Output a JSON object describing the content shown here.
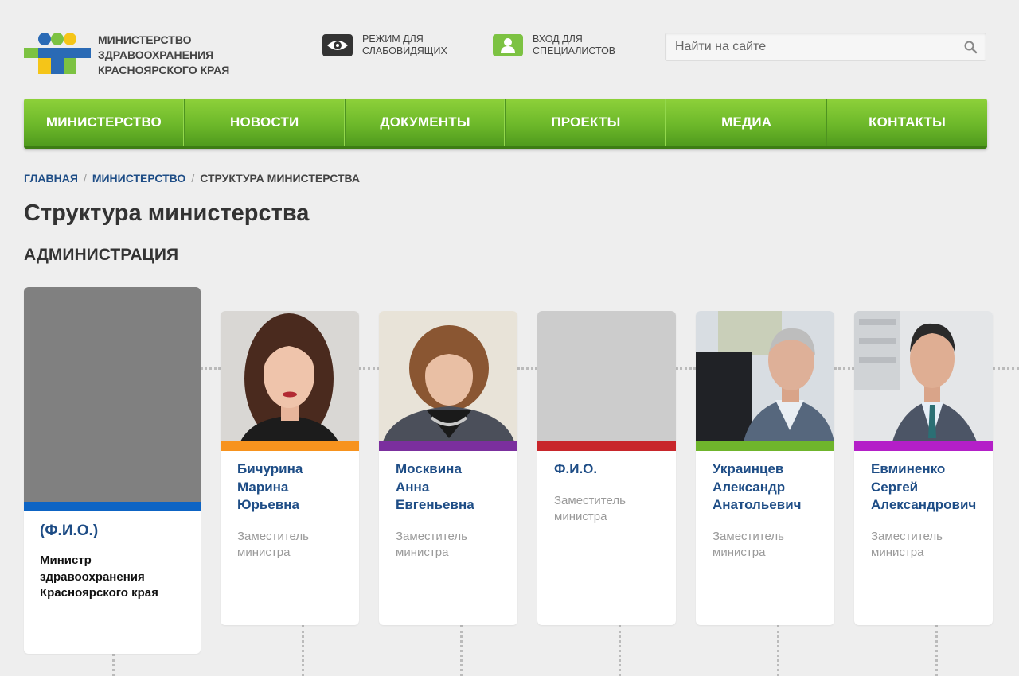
{
  "header": {
    "org_lines": [
      "МИНИСТЕРСТВО",
      "ЗДРАВООХРАНЕНИЯ",
      "КРАСНОЯРСКОГО КРАЯ"
    ],
    "vision_mode": [
      "РЕЖИМ ДЛЯ",
      "СЛАБОВИДЯЩИХ"
    ],
    "specialist_login": [
      "ВХОД ДЛЯ",
      "СПЕЦИАЛИСТОВ"
    ],
    "search_placeholder": "Найти на сайте"
  },
  "nav": {
    "items": [
      "МИНИСТЕРСТВО",
      "НОВОСТИ",
      "ДОКУМЕНТЫ",
      "ПРОЕКТЫ",
      "МЕДИА",
      "КОНТАКТЫ"
    ]
  },
  "breadcrumb": {
    "home": "ГЛАВНАЯ",
    "ministry": "МИНИСТЕРСТВО",
    "current": "СТРУКТУРА МИНИСТЕРСТВА",
    "separator": "/"
  },
  "page_title": "Структура министерства",
  "section_title": "АДМИНИСТРАЦИЯ",
  "minister": {
    "name": "(Ф.И.О.)",
    "role_lines": [
      "Министр",
      "здравоохранения",
      "Красноярского края"
    ],
    "stripe_color": "#0d64c4"
  },
  "deputies": [
    {
      "name_lines": [
        "Бичурина",
        "Марина",
        "Юрьевна"
      ],
      "role_lines": [
        "Заместитель",
        "министра"
      ],
      "stripe_color": "#f7931e"
    },
    {
      "name_lines": [
        "Москвина",
        "Анна",
        "Евгеньевна"
      ],
      "role_lines": [
        "Заместитель",
        "министра"
      ],
      "stripe_color": "#7b2f9e"
    },
    {
      "name_lines": [
        "Ф.И.О."
      ],
      "role_lines": [
        "Заместитель",
        "министра"
      ],
      "stripe_color": "#c8262b"
    },
    {
      "name_lines": [
        "Украинцев",
        "Александр",
        "Анатольевич"
      ],
      "role_lines": [
        "Заместитель",
        "министра"
      ],
      "stripe_color": "#6fb52c"
    },
    {
      "name_lines": [
        "Евминенко",
        "Сергей",
        "Александрович"
      ],
      "role_lines": [
        "Заместитель",
        "министра"
      ],
      "stripe_color": "#b41fc8"
    }
  ],
  "colors": {
    "nav_green": "#6db82a",
    "link_blue": "#1e4d86",
    "logo_blue": "#2a6ab5",
    "logo_green": "#7cc242",
    "logo_yellow": "#f5c518"
  }
}
